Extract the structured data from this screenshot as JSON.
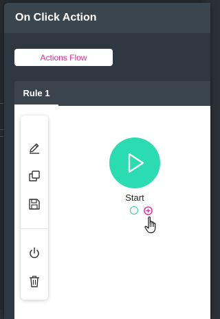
{
  "dialog": {
    "title": "On Click Action"
  },
  "actions_flow_button": {
    "label": "Actions Flow"
  },
  "tabs": [
    {
      "label": "Rule 1",
      "active": true
    }
  ],
  "toolbar": {
    "items": [
      {
        "icon": "pencil-icon",
        "action": "edit"
      },
      {
        "icon": "duplicate-icon",
        "action": "duplicate"
      },
      {
        "icon": "save-icon",
        "action": "save"
      },
      {
        "icon": "power-icon",
        "action": "toggle"
      },
      {
        "icon": "trash-icon",
        "action": "delete"
      }
    ]
  },
  "flow": {
    "start_node": {
      "label": "Start",
      "color": "#2bdbb2"
    }
  },
  "colors": {
    "accent": "#e0289a",
    "node": "#2bdbb2",
    "dialog_bg": "#313a42"
  }
}
